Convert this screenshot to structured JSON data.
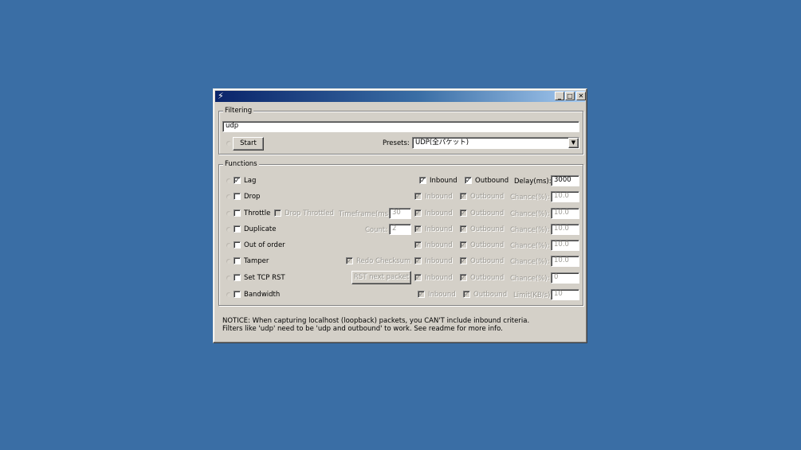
{
  "titlebar": {
    "icon": "lightning-icon",
    "buttons": {
      "minimize": "_",
      "maximize": "□",
      "close": "✕"
    }
  },
  "filtering": {
    "group_label": "Filtering",
    "filter_value": "udp",
    "start_label": "Start",
    "presets_label": "Presets:",
    "presets_value": "UDP(全パケット)"
  },
  "functions": {
    "group_label": "Functions",
    "rows": [
      {
        "name": "Lag",
        "enabled": true,
        "inbound_label": "Inbound",
        "inbound_checked": true,
        "outbound_label": "Outbound",
        "outbound_checked": true,
        "param_label": "Delay(ms):",
        "param_value": "3000"
      },
      {
        "name": "Drop",
        "enabled": false,
        "inbound_label": "Inbound",
        "inbound_checked": true,
        "outbound_label": "Outbound",
        "outbound_checked": true,
        "param_label": "Chance(%):",
        "param_value": "10.0"
      },
      {
        "name": "Throttle",
        "enabled": false,
        "extra_check_label": "Drop Throttled",
        "extra_label": "Timeframe(ms):",
        "extra_value": "30",
        "inbound_label": "Inbound",
        "inbound_checked": true,
        "outbound_label": "Outbound",
        "outbound_checked": true,
        "param_label": "Chance(%):",
        "param_value": "10.0"
      },
      {
        "name": "Duplicate",
        "enabled": false,
        "extra_label": "Count:",
        "extra_value": "2",
        "inbound_label": "Inbound",
        "inbound_checked": true,
        "outbound_label": "Outbound",
        "outbound_checked": true,
        "param_label": "Chance(%):",
        "param_value": "10.0"
      },
      {
        "name": "Out of order",
        "enabled": false,
        "inbound_label": "Inbound",
        "inbound_checked": true,
        "outbound_label": "Outbound",
        "outbound_checked": true,
        "param_label": "Chance(%):",
        "param_value": "10.0"
      },
      {
        "name": "Tamper",
        "enabled": false,
        "extra_check_label": "Redo Checksum",
        "inbound_label": "Inbound",
        "inbound_checked": true,
        "outbound_label": "Outbound",
        "outbound_checked": true,
        "param_label": "Chance(%):",
        "param_value": "10.0"
      },
      {
        "name": "Set TCP RST",
        "enabled": false,
        "extra_button_label": "RST next packet",
        "inbound_label": "Inbound",
        "inbound_checked": true,
        "outbound_label": "Outbound",
        "outbound_checked": true,
        "param_label": "Chance(%):",
        "param_value": "0"
      },
      {
        "name": "Bandwidth",
        "enabled": false,
        "inbound_label": "Inbound",
        "inbound_checked": true,
        "outbound_label": "Outbound",
        "outbound_checked": true,
        "param_label": "Limit(KB/s):",
        "param_value": "10"
      }
    ]
  },
  "notice": {
    "line1": "NOTICE: When capturing localhost (loopback) packets, you CAN'T include inbound criteria.",
    "line2": "Filters like 'udp' need to be 'udp and outbound' to work. See readme for more info."
  }
}
